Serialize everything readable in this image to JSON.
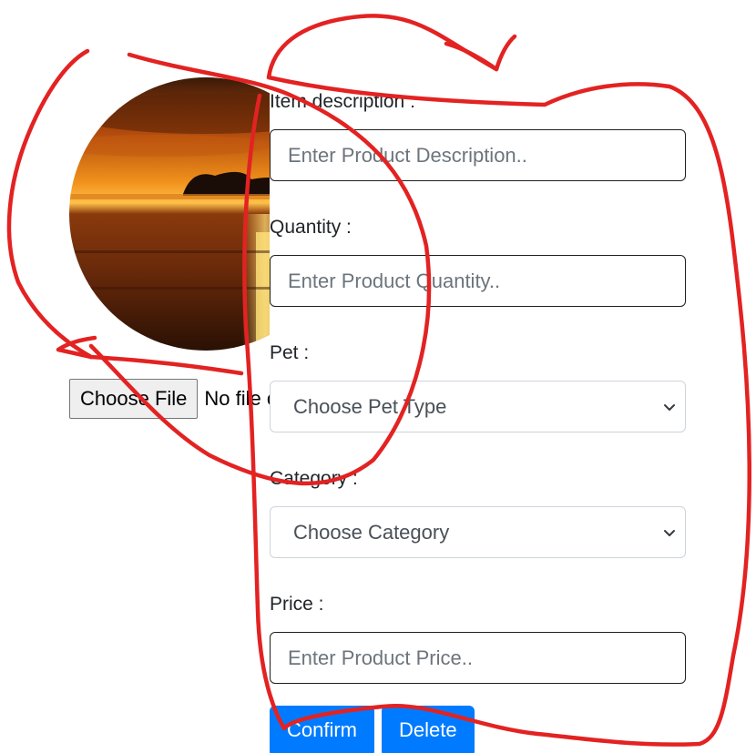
{
  "file_input": {
    "button_label": "Choose File",
    "status_text": "No file chosen"
  },
  "form": {
    "description": {
      "label": "Item description :",
      "placeholder": "Enter Product Description.."
    },
    "quantity": {
      "label": "Quantity :",
      "placeholder": "Enter Product Quantity.."
    },
    "pet": {
      "label": "Pet :",
      "selected": "Choose Pet Type"
    },
    "category": {
      "label": "Category :",
      "selected": "Choose Category"
    },
    "price": {
      "label": "Price :",
      "placeholder": "Enter Product Price.."
    }
  },
  "actions": {
    "confirm_label": "Confirm",
    "delete_label": "Delete"
  },
  "colors": {
    "primary": "#007bff",
    "annotation": "#e32222"
  }
}
